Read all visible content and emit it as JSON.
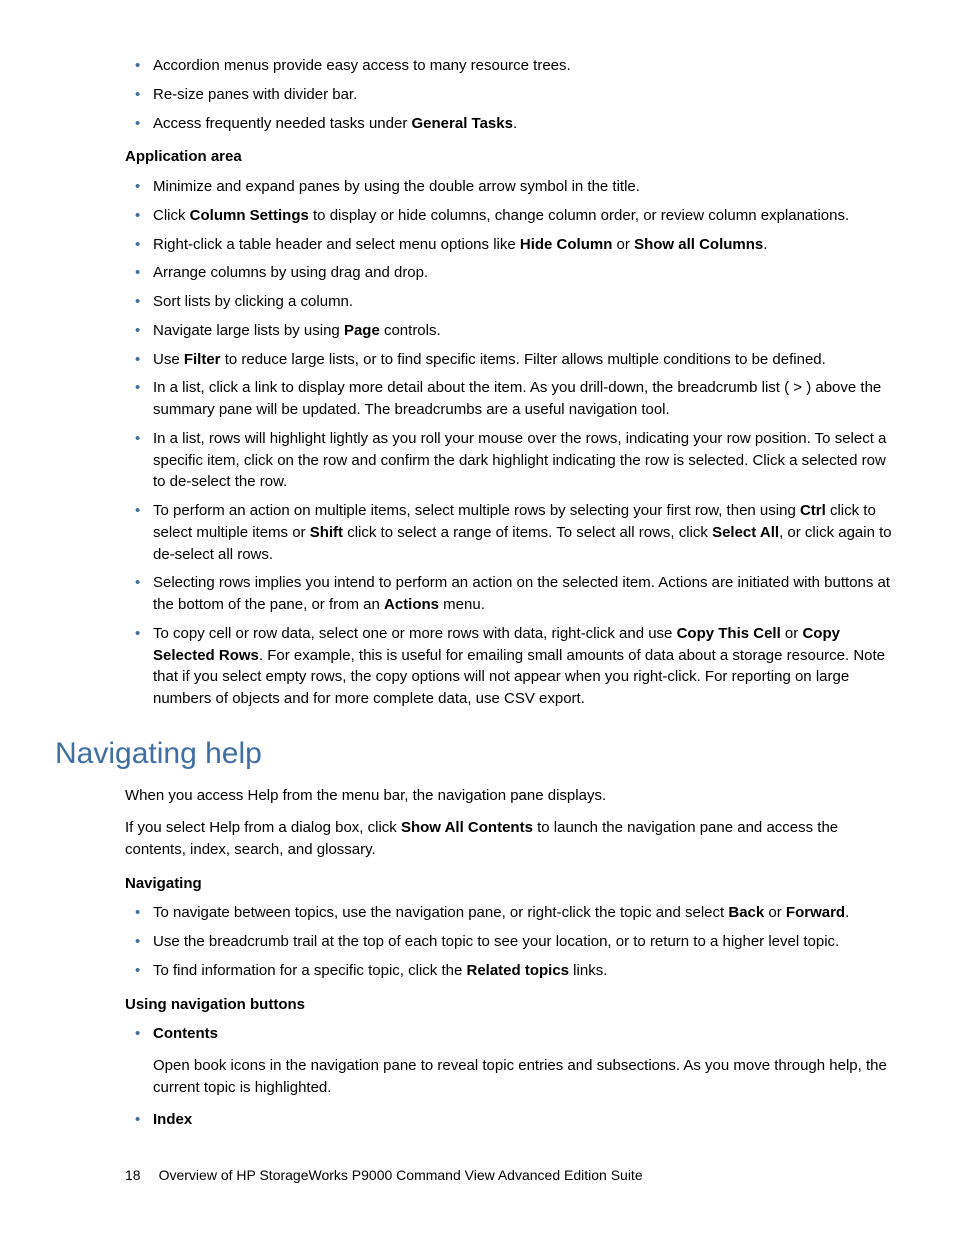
{
  "intro_bullets": [
    {
      "text": "Accordion menus provide easy access to many resource trees."
    },
    {
      "text": "Re-size panes with divider bar."
    },
    {
      "pre": "Access frequently needed tasks under ",
      "b1": "General Tasks",
      "post": "."
    }
  ],
  "sec1_head": "Application area",
  "sec1": {
    "b1": "Minimize and expand panes by using the double arrow symbol in the title.",
    "b2_pre": "Click ",
    "b2_b": "Column Settings",
    "b2_post": " to display or hide columns, change column order, or review column explanations.",
    "b3_pre": "Right-click a table header and select menu options like ",
    "b3_b1": "Hide Column",
    "b3_mid": " or ",
    "b3_b2": "Show all Columns",
    "b3_post": ".",
    "b4": "Arrange columns by using drag and drop.",
    "b5": "Sort lists by clicking a column.",
    "b6_pre": "Navigate large lists by using ",
    "b6_b": "Page",
    "b6_post": " controls.",
    "b7_pre": "Use ",
    "b7_b": "Filter",
    "b7_post": " to reduce large lists, or to find specific items. Filter allows multiple conditions to be defined.",
    "b8": "In a list, click a link to display more detail about the item. As you drill-down, the breadcrumb list (          >            ) above the summary pane will be updated. The breadcrumbs are a useful navigation tool.",
    "b9": "In a list, rows will highlight lightly as you roll your mouse over the rows, indicating your row position. To select a specific item, click on the row and confirm the dark highlight indicating the row is selected. Click a selected row to de-select the row.",
    "b10_pre": "To perform an action on multiple items, select multiple rows by selecting your first row, then using ",
    "b10_b1": "Ctrl",
    "b10_mid1": " click to select multiple items or ",
    "b10_b2": "Shift",
    "b10_mid2": " click to select a range of items. To select all rows, click ",
    "b10_b3": "Select All",
    "b10_post": ", or click again to de-select all rows.",
    "b11_pre": "Selecting rows implies you intend to perform an action on the selected item. Actions are initiated with buttons at the bottom of the pane, or from an ",
    "b11_b": "Actions",
    "b11_post": " menu.",
    "b12_pre": "To copy cell or row data, select one or more rows with data, right-click and use ",
    "b12_b1": "Copy This Cell",
    "b12_mid": " or ",
    "b12_b2": "Copy Selected Rows",
    "b12_post": ". For example, this is useful for emailing small amounts of data about a storage resource. Note that if you select empty rows, the copy options will not appear when you right-click. For reporting on large numbers of objects and for more complete data, use CSV export."
  },
  "h1": "Navigating help",
  "nav_p1": "When you access Help from the menu bar, the navigation pane displays.",
  "nav_p2_pre": "If you select Help from a dialog box, click ",
  "nav_p2_b": "Show All Contents",
  "nav_p2_post": " to launch the navigation pane and access the contents, index, search, and glossary.",
  "nav_head": "Navigating",
  "nav": {
    "b1_pre": "To navigate between topics, use the navigation pane, or right-click the topic and select ",
    "b1_b1": "Back",
    "b1_mid": " or ",
    "b1_b2": "Forward",
    "b1_post": ".",
    "b2": "Use the breadcrumb trail at the top of each topic to see your location, or to return to a higher level topic.",
    "b3_pre": "To find information for a specific topic, click the ",
    "b3_b": "Related topics",
    "b3_post": " links."
  },
  "btn_head": "Using navigation buttons",
  "btn": {
    "c_label": "Contents",
    "c_text": "Open book icons in the navigation pane to reveal topic entries and subsections. As you move through help, the current topic is highlighted.",
    "i_label": "Index"
  },
  "footer": {
    "page": "18",
    "title": "Overview of HP StorageWorks P9000 Command View Advanced Edition Suite"
  }
}
